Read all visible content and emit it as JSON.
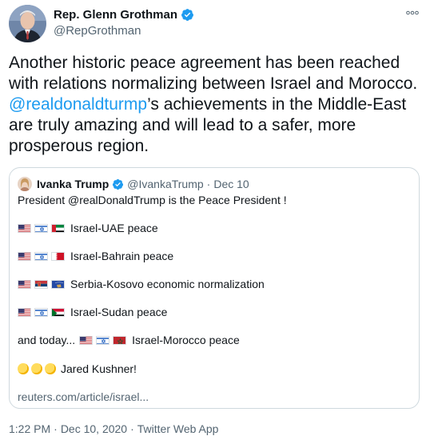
{
  "author": {
    "name": "Rep. Glenn Grothman",
    "handle": "@RepGrothman"
  },
  "tweet": {
    "text_part1": "Another historic peace agreement has been reached with relations normalizing between Israel and Morocco. ",
    "mention": "@realdonaldturmp",
    "text_part2": "’s achievements in the Middle-East are truly amazing and will lead to a safer, more prosperous region."
  },
  "quote": {
    "name": "Ivanka Trump",
    "handle": "@IvankaTrump",
    "separator": "·",
    "date": "Dec 10",
    "intro": "President @realDonaldTrump is the Peace President !",
    "items": [
      {
        "flags": [
          "us",
          "israel",
          "uae"
        ],
        "text": "Israel-UAE peace"
      },
      {
        "flags": [
          "us",
          "israel",
          "bahrain"
        ],
        "text": "Israel-Bahrain peace"
      },
      {
        "flags": [
          "us",
          "serbia",
          "kosovo"
        ],
        "text": "Serbia-Kosovo economic normalization"
      },
      {
        "flags": [
          "us",
          "israel",
          "sudan"
        ],
        "text": "Israel-Sudan peace"
      }
    ],
    "today_prefix": "and today...",
    "today_flags": [
      "us",
      "israel",
      "morocco"
    ],
    "today_text": "Israel-Morocco peace",
    "kushner_text": "Jared Kushner!",
    "link": "reuters.com/article/israel..."
  },
  "footer": {
    "time": "1:22 PM",
    "dot1": "·",
    "date": "Dec 10, 2020",
    "dot2": "·",
    "source": "Twitter Web App"
  },
  "colors": {
    "link_blue": "#1d9bf0",
    "muted": "#536471",
    "border": "#cfd9de"
  }
}
